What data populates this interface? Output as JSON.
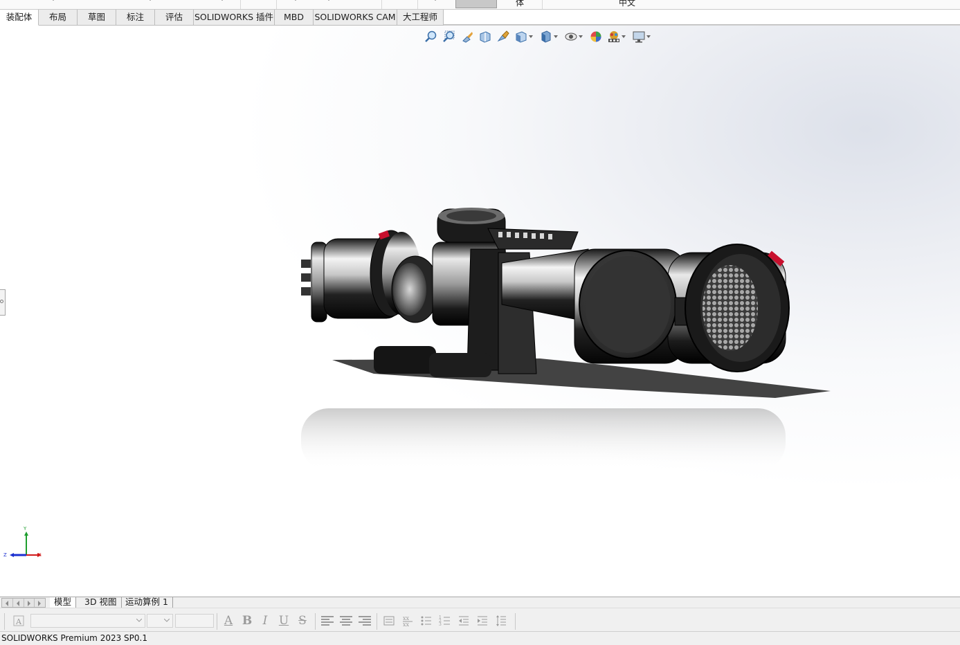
{
  "window": {
    "top_labels": [
      "体",
      "中文"
    ]
  },
  "command_tabs": [
    {
      "label": "装配体",
      "active": true
    },
    {
      "label": "布局"
    },
    {
      "label": "草图"
    },
    {
      "label": "标注"
    },
    {
      "label": "评估"
    },
    {
      "label": "SOLIDWORKS 插件"
    },
    {
      "label": "MBD"
    },
    {
      "label": "SOLIDWORKS CAM"
    },
    {
      "label": "大工程师"
    }
  ],
  "heads_up_toolbar": [
    {
      "icon": "zoom-to-fit-icon"
    },
    {
      "icon": "zoom-to-area-icon"
    },
    {
      "icon": "previous-view-icon"
    },
    {
      "icon": "section-view-icon"
    },
    {
      "icon": "dynamic-annotation-icon"
    },
    {
      "icon": "view-orientation-icon",
      "dropdown": true
    },
    {
      "icon": "display-style-icon",
      "dropdown": true
    },
    {
      "icon": "hide-show-items-icon",
      "dropdown": true
    },
    {
      "icon": "edit-appearance-icon"
    },
    {
      "icon": "apply-scene-icon",
      "dropdown": true
    },
    {
      "icon": "view-settings-icon",
      "dropdown": true
    }
  ],
  "triad": {
    "x": "X",
    "y": "Y",
    "z": "Z"
  },
  "bottom_tabs": [
    {
      "label": "模型",
      "active": true
    },
    {
      "label": "3D 视图"
    },
    {
      "label": "运动算例 1"
    }
  ],
  "format_toolbar": {
    "bold": "B",
    "italic": "I",
    "underline": "U",
    "strikethrough": "S",
    "font_color": "A"
  },
  "status_bar": {
    "text": "SOLIDWORKS Premium 2023 SP0.1"
  },
  "colors": {
    "accent_red": "#c8102e",
    "tab_active": "#ffffff",
    "tab_inactive": "#ececec"
  }
}
